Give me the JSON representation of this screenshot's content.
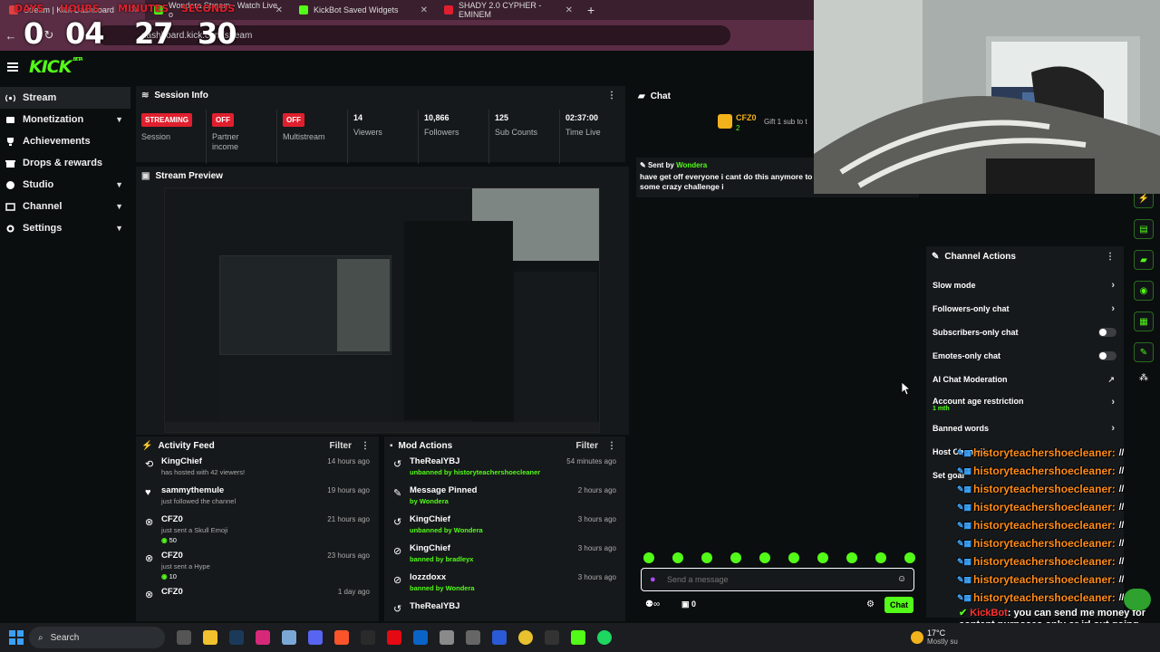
{
  "browser": {
    "tabs": [
      {
        "label": "Stream | Kick Dashboard",
        "color": "#e24040"
      },
      {
        "label": "Wondera Stream - Watch Live o",
        "color": "#53fc18"
      },
      {
        "label": "KickBot Saved Widgets",
        "color": "#53fc18"
      },
      {
        "label": "SHADY 2.0 CYPHER - EMINEM",
        "color": "#e01f2e"
      }
    ],
    "url": "dashboard.kick.com/stream"
  },
  "timer": {
    "labels": {
      "days": "DAYS",
      "hours": "HOURS",
      "minutes": "MINUTES",
      "seconds": "SECONDS"
    },
    "days": "0",
    "hours": "04",
    "minutes": "27",
    "seconds": "30"
  },
  "header": {
    "logo": "KICK",
    "beta": "BETA"
  },
  "sidebar": {
    "items": [
      {
        "label": "Stream",
        "icon": "broadcast-icon"
      },
      {
        "label": "Monetization",
        "icon": "money-icon"
      },
      {
        "label": "Achievements",
        "icon": "trophy-icon"
      },
      {
        "label": "Drops & rewards",
        "icon": "gift-icon"
      },
      {
        "label": "Studio",
        "icon": "studio-icon"
      },
      {
        "label": "Channel",
        "icon": "channel-icon"
      },
      {
        "label": "Settings",
        "icon": "gear-icon"
      }
    ]
  },
  "session": {
    "title": "Session Info",
    "stats": [
      {
        "badge": "STREAMING",
        "label": "Session"
      },
      {
        "badge": "OFF",
        "label": "Partner income"
      },
      {
        "badge": "OFF",
        "label": "Multistream"
      },
      {
        "value": "14",
        "label": "Viewers"
      },
      {
        "value": "10,866",
        "label": "Followers"
      },
      {
        "value": "125",
        "label": "Sub Counts"
      },
      {
        "value": "02:37:00",
        "label": "Time Live"
      }
    ]
  },
  "preview": {
    "title": "Stream Preview"
  },
  "activity": {
    "title": "Activity Feed",
    "filter": "Filter",
    "items": [
      {
        "name": "KingChief",
        "sub": "has hosted with 42 viewers!",
        "time": "14 hours ago"
      },
      {
        "name": "sammythemule",
        "sub": "just followed the channel",
        "time": "19 hours ago"
      },
      {
        "name": "CFZ0",
        "sub": "just sent a Skull Emoji",
        "extra": "50",
        "time": "21 hours ago"
      },
      {
        "name": "CFZ0",
        "sub": "just sent a Hype",
        "extra": "10",
        "time": "23 hours ago"
      },
      {
        "name": "CFZ0",
        "sub": "",
        "time": "1 day ago"
      }
    ]
  },
  "mod": {
    "title": "Mod Actions",
    "filter": "Filter",
    "items": [
      {
        "name": "TheRealYBJ",
        "sub": "unbanned by historyteachershoecleaner",
        "time": "54 minutes ago"
      },
      {
        "name": "Message Pinned",
        "sub": "by Wondera",
        "time": "2 hours ago"
      },
      {
        "name": "KingChief",
        "sub": "unbanned by Wondera",
        "time": "3 hours ago"
      },
      {
        "name": "KingChief",
        "sub": "banned by bradleyx",
        "time": "3 hours ago"
      },
      {
        "name": "lozzdoxx",
        "sub": "banned by Wondera",
        "time": "3 hours ago"
      },
      {
        "name": "TheRealYBJ",
        "sub": "",
        "time": ""
      }
    ]
  },
  "chat": {
    "title": "Chat",
    "gifter": "CFZ0",
    "gifter_count": "2",
    "gift_text": "Gift 1 sub to t",
    "pinned_by": "Sent by",
    "pinned_user": "Wondera",
    "pinned_text": "have get off everyone i cant do this anymore to had 7 hours left i will do some crazy challenge i",
    "input_placeholder": "Send a message",
    "send_label": "Chat",
    "footer_count": "0"
  },
  "channel_actions": {
    "title": "Channel Actions",
    "items": [
      {
        "label": "Slow mode",
        "kind": "chevron"
      },
      {
        "label": "Followers-only chat",
        "kind": "chevron"
      },
      {
        "label": "Subscribers-only chat",
        "kind": "toggle"
      },
      {
        "label": "Emotes-only chat",
        "kind": "toggle"
      },
      {
        "label": "AI Chat Moderation",
        "kind": "external"
      },
      {
        "label": "Account age restriction",
        "sub": "1 mth",
        "kind": "chevron"
      },
      {
        "label": "Banned words",
        "kind": "chevron"
      },
      {
        "label": "Host Channel",
        "kind": "none"
      },
      {
        "label": "Set goal",
        "kind": "none"
      }
    ]
  },
  "overlay_chat": {
    "user": "historyteachershoecleaner:",
    "rows": 9,
    "bot_name": "KickBot",
    "bot_text": ": you can send me money for content purposes only or irl out going here is the link revolut.me/wonderakick"
  },
  "taskbar": {
    "search": "Search",
    "weather_temp": "17°C",
    "weather_sub": "Mostly su"
  }
}
